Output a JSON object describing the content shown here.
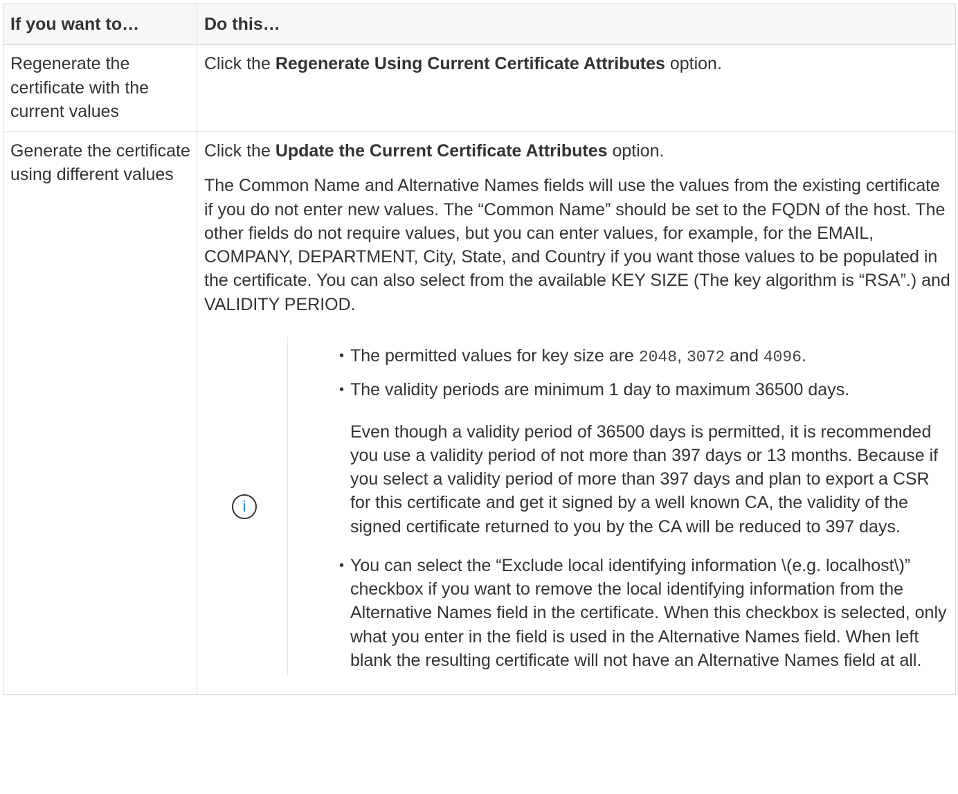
{
  "header": {
    "col1": "If you want to…",
    "col2": "Do this…"
  },
  "rows": [
    {
      "want": "Regenerate the certificate with the current values",
      "action_pre": "Click the ",
      "action_bold": "Regenerate Using Current Certificate Attributes",
      "action_post": " option."
    },
    {
      "want": "Generate the certificate using different values",
      "action_pre": "Click the ",
      "action_bold": "Update the Current Certificate Attributes",
      "action_post": " option.",
      "description": "The Common Name and Alternative Names fields will use the values from the existing certificate if you do not enter new values. The “Common Name” should be set to the FQDN of the host. The other fields do not require values, but you can enter values, for example, for the EMAIL, COMPANY, DEPARTMENT, City, State, and Country if you want those values to be populated in the certificate. You can also select from the available KEY SIZE (The key algorithm is “RSA”.) and VALIDITY PERIOD.",
      "note": {
        "icon": "info-icon",
        "icon_glyph": "i",
        "bullet1_pre": "The permitted values for key size are ",
        "key_size_1": "2048",
        "bullet1_sep1": ", ",
        "key_size_2": "3072",
        "bullet1_sep2": " and ",
        "key_size_3": "4096",
        "bullet1_post": ".",
        "bullet2": "The validity periods are minimum 1 day to maximum 36500 days.",
        "bullet2_sub": "Even though a validity period of 36500 days is permitted, it is recommended you use a validity period of not more than 397 days or 13 months. Because if you select a validity period of more than 397 days and plan to export a CSR for this certificate and get it signed by a well known CA, the validity of the signed certificate returned to you by the CA will be reduced to 397 days.",
        "bullet3": "You can select the “Exclude local identifying information \\(e.g. localhost\\)” checkbox if you want to remove the local identifying information from the Alternative Names field in the certificate. When this checkbox is selected, only what you enter in the field is used in the Alternative Names field. When left blank the resulting certificate will not have an Alternative Names field at all."
      }
    }
  ]
}
